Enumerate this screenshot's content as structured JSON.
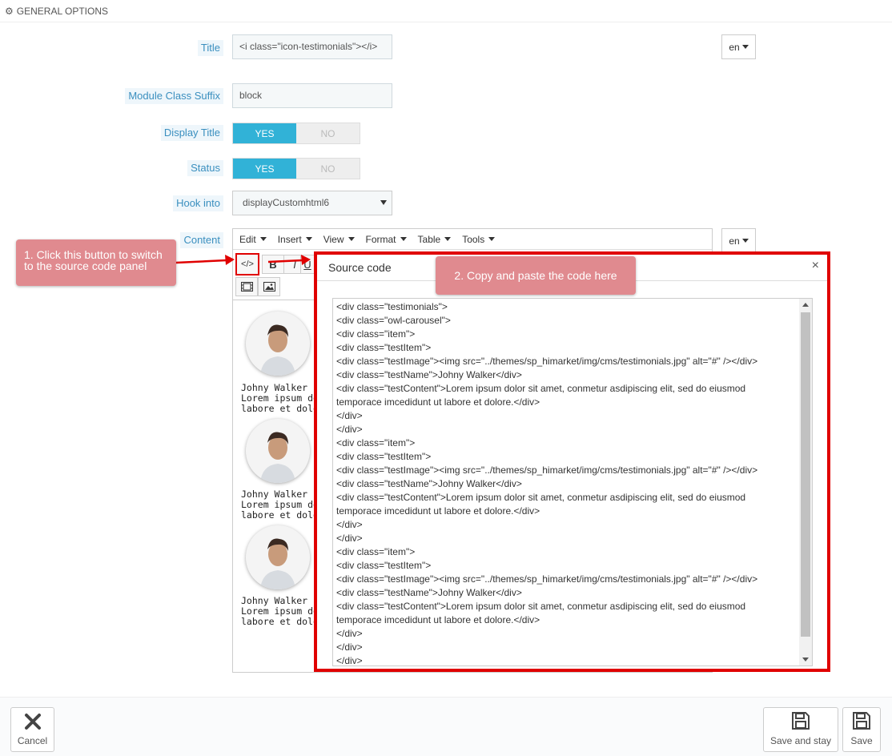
{
  "header": {
    "icon": "gears-icon",
    "title": "GENERAL OPTIONS"
  },
  "form": {
    "title": {
      "label": "Title",
      "value": "<i class=\"icon-testimonials\"></i>",
      "lang": "en"
    },
    "class_suffix": {
      "label": "Module Class Suffix",
      "value": "block"
    },
    "display_title": {
      "label": "Display Title",
      "yes": "YES",
      "no": "NO",
      "selected": "YES"
    },
    "status": {
      "label": "Status",
      "yes": "YES",
      "no": "NO",
      "selected": "YES"
    },
    "hook": {
      "label": "Hook into",
      "value": "displayCustomhtml6"
    },
    "content": {
      "label": "Content",
      "lang": "en"
    }
  },
  "editor": {
    "menu": [
      "Edit",
      "Insert",
      "View",
      "Format",
      "Table",
      "Tools"
    ],
    "toolbar": {
      "source": "</>",
      "bold": "B",
      "italic": "I",
      "underline": "U"
    },
    "preview": [
      {
        "name": "Johny Walker",
        "line1": "Lorem ipsum dolor",
        "line2": "labore et dolore."
      },
      {
        "name": "Johny Walker",
        "line1": "Lorem ipsum dolor",
        "line2": "labore et dolore."
      },
      {
        "name": "Johny Walker",
        "line1": "Lorem ipsum dolor",
        "line2": "labore et dolore."
      }
    ]
  },
  "callouts": {
    "first": "1. Click this button to switch to the source code panel",
    "second": "2. Copy and paste the code here"
  },
  "dialog": {
    "title": "Source code",
    "close": "×",
    "lines": [
      "<div class=\"testimonials\">",
      "<div class=\"owl-carousel\">",
      "<div class=\"item\">",
      "<div class=\"testItem\">",
      "<div class=\"testImage\"><img src=\"../themes/sp_himarket/img/cms/testimonials.jpg\" alt=\"#\" /></div>",
      "<div class=\"testName\">Johny Walker</div>",
      "<div class=\"testContent\">Lorem ipsum dolor sit amet, conmetur asdipiscing elit, sed do eiusmod",
      "temporace imcedidunt ut labore et dolore.</div>",
      "</div>",
      "</div>",
      "<div class=\"item\">",
      "<div class=\"testItem\">",
      "<div class=\"testImage\"><img src=\"../themes/sp_himarket/img/cms/testimonials.jpg\" alt=\"#\" /></div>",
      "<div class=\"testName\">Johny Walker</div>",
      "<div class=\"testContent\">Lorem ipsum dolor sit amet, conmetur asdipiscing elit, sed do eiusmod",
      "temporace imcedidunt ut labore et dolore.</div>",
      "</div>",
      "</div>",
      "<div class=\"item\">",
      "<div class=\"testItem\">",
      "<div class=\"testImage\"><img src=\"../themes/sp_himarket/img/cms/testimonials.jpg\" alt=\"#\" /></div>",
      "<div class=\"testName\">Johny Walker</div>",
      "<div class=\"testContent\">Lorem ipsum dolor sit amet, conmetur asdipiscing elit, sed do eiusmod",
      "temporace imcedidunt ut labore et dolore.</div>",
      "</div>",
      "</div>",
      "</div>"
    ]
  },
  "footer": {
    "cancel": "Cancel",
    "save_stay": "Save and stay",
    "save": "Save"
  },
  "colors": {
    "accent": "#31b2d7",
    "callout": "#e08a8f",
    "highlight": "#e00000"
  }
}
